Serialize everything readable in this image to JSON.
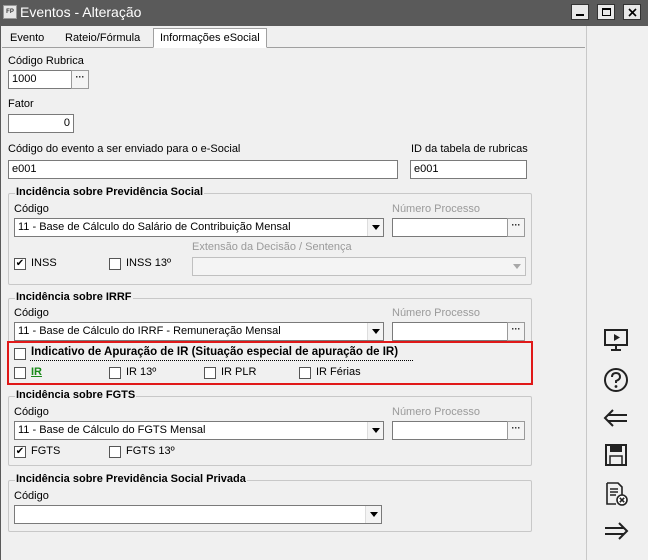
{
  "window": {
    "title": "Eventos - Alteração",
    "app_icon": "FP"
  },
  "tabs": [
    {
      "label": "Evento",
      "active": false
    },
    {
      "label": "Rateio/Fórmula",
      "active": false
    },
    {
      "label": "Informações eSocial",
      "active": true
    }
  ],
  "fields": {
    "codigo_rubrica": {
      "label": "Código Rubrica",
      "value": "1000"
    },
    "fator": {
      "label": "Fator",
      "value": "0"
    },
    "codigo_evento_esocial": {
      "label": "Código do evento a ser enviado para o e-Social",
      "value": "e001"
    },
    "id_tabela_rubricas": {
      "label": "ID da tabela de rubricas",
      "value": "e001"
    }
  },
  "prev_social": {
    "title": "Incidência sobre Previdência Social",
    "codigo_label": "Código",
    "codigo_value": "11 - Base de Cálculo do Salário de Contribuição Mensal",
    "numero_processo_label": "Número Processo",
    "numero_processo_value": "",
    "extensao_label": "Extensão da Decisão / Sentença",
    "extensao_value": "",
    "checks": [
      {
        "label": "INSS",
        "checked": true
      },
      {
        "label": "INSS 13º",
        "checked": false
      }
    ]
  },
  "irrf": {
    "title": "Incidência sobre IRRF",
    "codigo_label": "Código",
    "codigo_value": "11 - Base de Cálculo do IRRF - Remuneração Mensal",
    "numero_processo_label": "Número Processo",
    "numero_processo_value": "",
    "indicativo": {
      "label": "Indicativo de Apuração de IR (Situação especial de apuração de IR)",
      "checked": false
    },
    "checks": [
      {
        "label": "IR",
        "checked": false
      },
      {
        "label": "IR 13º",
        "checked": false
      },
      {
        "label": "IR PLR",
        "checked": false
      },
      {
        "label": "IR Férias",
        "checked": false
      }
    ],
    "highlight_color": "#e01818"
  },
  "fgts": {
    "title": "Incidência sobre FGTS",
    "codigo_label": "Código",
    "codigo_value": "11 - Base de Cálculo do FGTS Mensal",
    "numero_processo_label": "Número Processo",
    "numero_processo_value": "",
    "checks": [
      {
        "label": "FGTS",
        "checked": true
      },
      {
        "label": "FGTS 13º",
        "checked": false
      }
    ]
  },
  "prev_privada": {
    "title": "Incidência sobre Previdência Social Privada",
    "codigo_label": "Código",
    "codigo_value": ""
  },
  "sidebar_icons": [
    "presentation-icon",
    "help-icon",
    "back-arrow-icon",
    "save-icon",
    "delete-document-icon",
    "forward-arrow-icon"
  ],
  "colors": {
    "titlebar": "#5a5a5a",
    "ir_label": "#1a8a1a"
  }
}
